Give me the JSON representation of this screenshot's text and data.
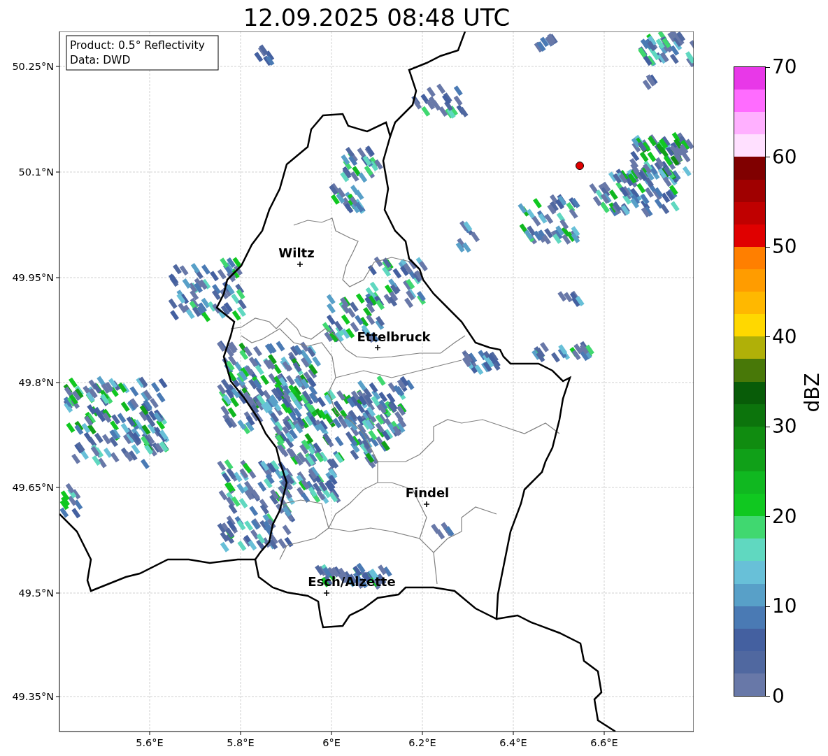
{
  "title": "12.09.2025 08:48 UTC",
  "info_box": [
    "Product: 0.5° Reflectivity",
    "Data: DWD"
  ],
  "map": {
    "latitude_labels": [
      "50.25°N",
      "50.1°N",
      "49.95°N",
      "49.8°N",
      "49.65°N",
      "49.5°N",
      "49.35°N"
    ],
    "longitude_labels": [
      "5.6°E",
      "5.8°E",
      "6°E",
      "6.2°E",
      "6.4°E",
      "6.6°E"
    ],
    "cities": [
      {
        "name": "Wiltz"
      },
      {
        "name": "Ettelbruck"
      },
      {
        "name": "Findel"
      },
      {
        "name": "Esch/Alzette"
      }
    ]
  },
  "colorbar": {
    "label": "dBZ",
    "ticks": [
      "70",
      "60",
      "50",
      "40",
      "30",
      "20",
      "10",
      "0"
    ],
    "colors": [
      {
        "color": "#e838e8"
      },
      {
        "color": "#ff6cff"
      },
      {
        "color": "#ffb0ff"
      },
      {
        "color": "#ffe0ff"
      },
      {
        "color": "#800000"
      },
      {
        "color": "#a00000"
      },
      {
        "color": "#c00000"
      },
      {
        "color": "#e00000"
      },
      {
        "color": "#ff7f00"
      },
      {
        "color": "#ff9c00"
      },
      {
        "color": "#ffb800"
      },
      {
        "color": "#ffd800"
      },
      {
        "color": "#b0b008"
      },
      {
        "color": "#487808"
      },
      {
        "color": "#085c08"
      },
      {
        "color": "#0c740c"
      },
      {
        "color": "#108c10"
      },
      {
        "color": "#10a018"
      },
      {
        "color": "#10b820"
      },
      {
        "color": "#10c820"
      },
      {
        "color": "#40d870"
      },
      {
        "color": "#60d8c0"
      },
      {
        "color": "#68c0d8"
      },
      {
        "color": "#58a0c8"
      },
      {
        "color": "#4a7ab4"
      },
      {
        "color": "#4460a0"
      },
      {
        "color": "#5068a0"
      },
      {
        "color": "#6878a8"
      }
    ]
  }
}
